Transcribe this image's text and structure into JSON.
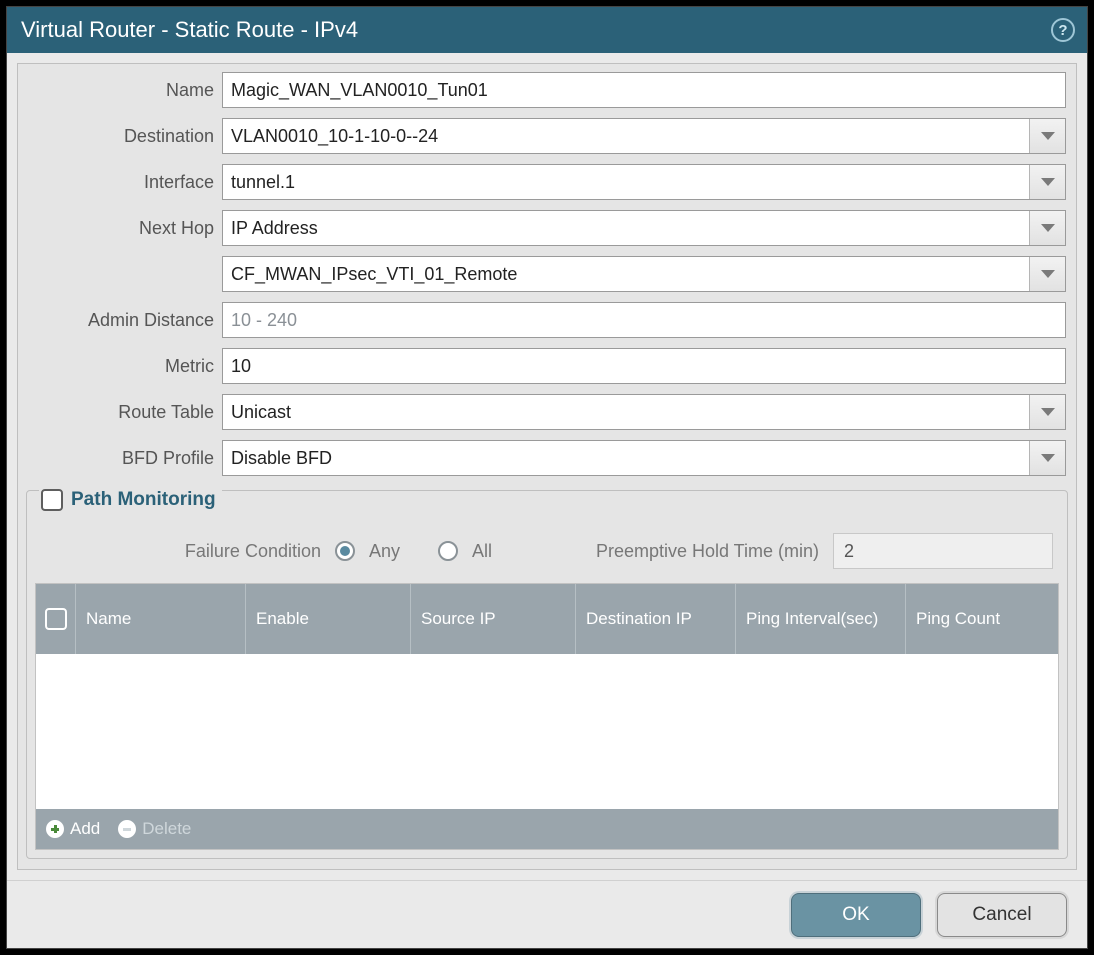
{
  "title": "Virtual Router - Static Route - IPv4",
  "help_tooltip": "Help",
  "labels": {
    "name": "Name",
    "destination": "Destination",
    "interface": "Interface",
    "next_hop": "Next Hop",
    "admin_distance": "Admin Distance",
    "metric": "Metric",
    "route_table": "Route Table",
    "bfd_profile": "BFD Profile"
  },
  "fields": {
    "name": "Magic_WAN_VLAN0010_Tun01",
    "destination": "VLAN0010_10-1-10-0--24",
    "interface": "tunnel.1",
    "next_hop_type": "IP Address",
    "next_hop_value": "CF_MWAN_IPsec_VTI_01_Remote",
    "admin_distance": "",
    "admin_distance_placeholder": "10 - 240",
    "metric": "10",
    "route_table": "Unicast",
    "bfd_profile": "Disable BFD"
  },
  "path_monitoring": {
    "legend": "Path Monitoring",
    "enabled": false,
    "failure_condition_label": "Failure Condition",
    "options": {
      "any": "Any",
      "all": "All"
    },
    "failure_condition": "any",
    "preemptive_label": "Preemptive Hold Time (min)",
    "preemptive_value": "2",
    "table": {
      "columns": {
        "name": "Name",
        "enable": "Enable",
        "source_ip": "Source IP",
        "destination_ip": "Destination IP",
        "ping_interval": "Ping Interval(sec)",
        "ping_count": "Ping Count"
      },
      "rows": []
    },
    "actions": {
      "add": "Add",
      "delete": "Delete"
    }
  },
  "footer": {
    "ok": "OK",
    "cancel": "Cancel"
  }
}
